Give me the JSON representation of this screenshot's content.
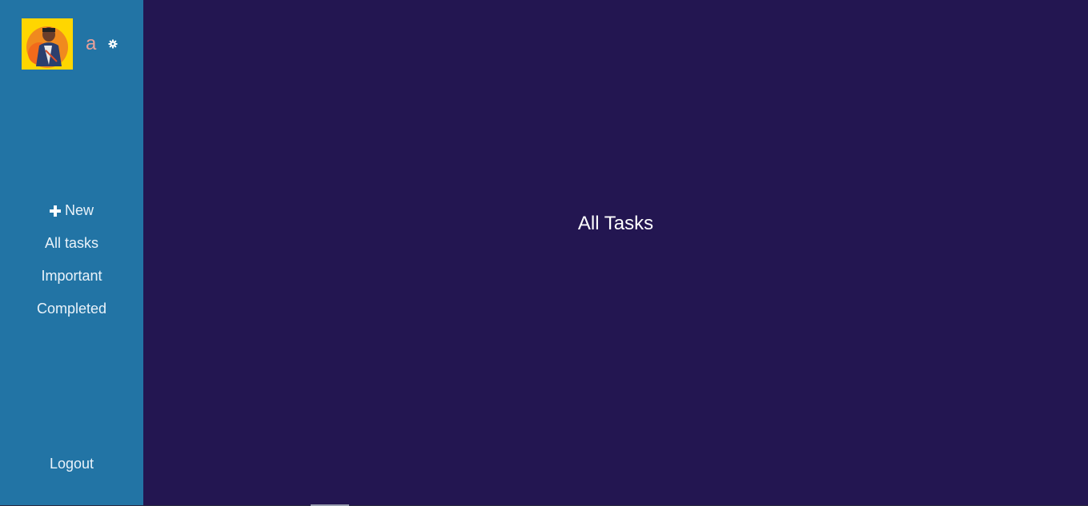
{
  "user": {
    "name": "a",
    "avatar_icon": "user-avatar-photo",
    "settings_icon": "gear-icon"
  },
  "sidebar": {
    "items": [
      {
        "label": "New",
        "icon": "plus-icon"
      },
      {
        "label": "All tasks"
      },
      {
        "label": "Important"
      },
      {
        "label": "Completed"
      }
    ],
    "logout_label": "Logout"
  },
  "main": {
    "title": "All Tasks"
  },
  "colors": {
    "sidebar_bg": "#2274A5",
    "main_bg": "#231651",
    "username": "#E8A09A",
    "avatar_bg": "#FFD600"
  }
}
